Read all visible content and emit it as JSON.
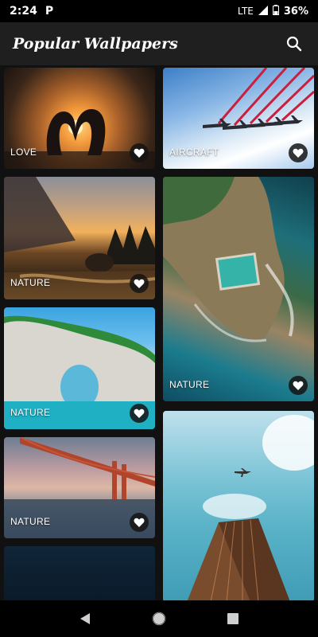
{
  "status_bar": {
    "time": "2:24",
    "app_badge": "P",
    "network": "LTE",
    "battery_percent": "36%"
  },
  "app_bar": {
    "title": "Popular Wallpapers",
    "search_icon": "search-icon"
  },
  "wallpapers": [
    {
      "id": "love",
      "label": "LOVE"
    },
    {
      "id": "aircraft",
      "label": "AIRCRAFT"
    },
    {
      "id": "nature-sunset",
      "label": "NATURE"
    },
    {
      "id": "nature-coast",
      "label": "NATURE"
    },
    {
      "id": "nature-arch",
      "label": "NATURE"
    },
    {
      "id": "nature-bridge",
      "label": "NATURE"
    },
    {
      "id": "building",
      "label": ""
    },
    {
      "id": "dark",
      "label": ""
    }
  ],
  "colors": {
    "background": "#111111",
    "app_bar": "#1f1f1f",
    "status_bar": "#000000",
    "nav_bar": "#000000"
  },
  "nav_bar": {
    "back_icon": "back-triangle-icon",
    "home_icon": "home-circle-icon",
    "recents_icon": "recents-square-icon"
  }
}
